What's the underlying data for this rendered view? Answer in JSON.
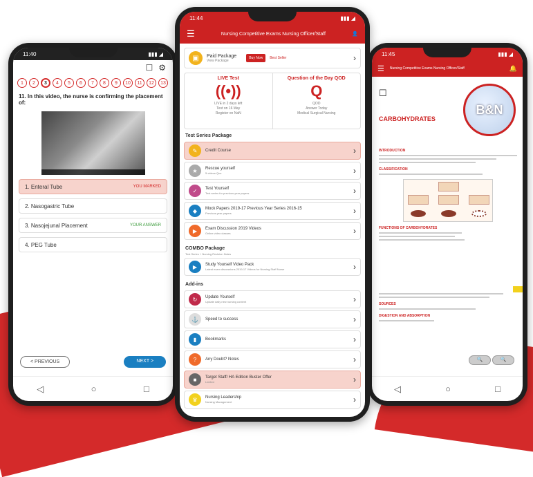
{
  "left_phone": {
    "time": "11:40",
    "question_numbers": [
      "1",
      "2",
      "3",
      "4",
      "5",
      "6",
      "7",
      "8",
      "9",
      "10",
      "11",
      "12",
      "13"
    ],
    "active_question": "3",
    "question": "11. In this video, the nurse is confirming the placement of:",
    "options": [
      {
        "label": "1. Enteral Tube",
        "tag": "YOU MARKED"
      },
      {
        "label": "2. Nasogastric Tube",
        "tag": ""
      },
      {
        "label": "3. Nasojejunal Placement",
        "tag": "YOUR ANSWER"
      },
      {
        "label": "4. PEG Tube",
        "tag": ""
      }
    ],
    "prev_label": "< PREVIOUS",
    "next_label": "NEXT >",
    "nav": [
      "◁",
      "○",
      "□"
    ]
  },
  "center_phone": {
    "time": "11:44",
    "app_title": "Nursing Competitive Exams Nursing Officer/Staff",
    "paid_package": {
      "title": "Paid Package",
      "subtitle": "View Package",
      "pill": "Buy Now",
      "extra": "Best Seller"
    },
    "live_test": {
      "title": "LIVE Test",
      "icon": "((•))",
      "line1": "LIVE in 2 days left",
      "line2": "Test on 16 May",
      "line3": "Register on NaN"
    },
    "qotd": {
      "title": "Question of the Day QOD",
      "icon": "Q",
      "line1": "QOD",
      "line2": "Answer Today",
      "line3": "Medical Surgical Nursing"
    },
    "test_series_heading": "Test Series Package",
    "test_series": [
      {
        "title": "Credit Course",
        "sub": "",
        "color": "#f2b31d",
        "icon": "✎"
      },
      {
        "title": "Rescue yourself",
        "sub": "5 videos Qns",
        "color": "#aaa",
        "icon": "★"
      },
      {
        "title": "Test Yourself",
        "sub": "Test series for previous year papers",
        "color": "#c04a8a",
        "icon": "✓"
      },
      {
        "title": "Mock Papers 2019-17 Previous Year Series 2016-15",
        "sub": "Previous year papers",
        "color": "#1a7fc1",
        "icon": "◆"
      },
      {
        "title": "Exam Discussion 2019 Videos",
        "sub": "Online video classes",
        "color": "#f06a2a",
        "icon": "▶"
      }
    ],
    "combo_heading": "COMBO Package",
    "combo_sub": "Test Series + Nursing Revision Notes",
    "combo": [
      {
        "title": "Study Yourself Video Pack",
        "sub": "Latest exam discussions 2019-17 Videos for Nursing Staff Nurse",
        "color": "#1a7fc1",
        "icon": "▶"
      }
    ],
    "addon_heading": "Add-ins",
    "addons": [
      {
        "title": "Update Yourself",
        "sub": "Update daily new nursing content",
        "color": "#c02a4a",
        "icon": "↻"
      },
      {
        "title": "Speed to success",
        "sub": "",
        "color": "#ddd",
        "icon": "⚓"
      },
      {
        "title": "Bookmarks",
        "sub": "",
        "color": "#1a7fc1",
        "icon": "▮"
      },
      {
        "title": "Any Doubt? Notes",
        "sub": "",
        "color": "#f06a2a",
        "icon": "?"
      },
      {
        "title": "Target Staff/ HA Edition Buster Offer",
        "sub": "Limited",
        "color": "#666",
        "icon": "■"
      },
      {
        "title": "Nursing Leadership",
        "sub": "Nursing Management",
        "color": "#f2d11d",
        "icon": "♛"
      }
    ]
  },
  "right_phone": {
    "time": "11:45",
    "app_title": "Nursing Competitive Exams Nursing Officer/Staff",
    "badge_text": "B&N",
    "heading": "CARBOHYDRATES",
    "sections": [
      "INTRODUCTION",
      "CLASSIFICATION",
      "FUNCTIONS OF CARBOHYDRATES",
      "SOURCES",
      "DIGESTION AND ABSORPTION"
    ],
    "zoom": [
      "🔍",
      "🔍"
    ],
    "nav": [
      "◁",
      "○",
      "□"
    ]
  },
  "colors": {
    "brand": "#cc2222",
    "accent_blue": "#1a7fc1",
    "highlight": "#f7d3cc"
  }
}
